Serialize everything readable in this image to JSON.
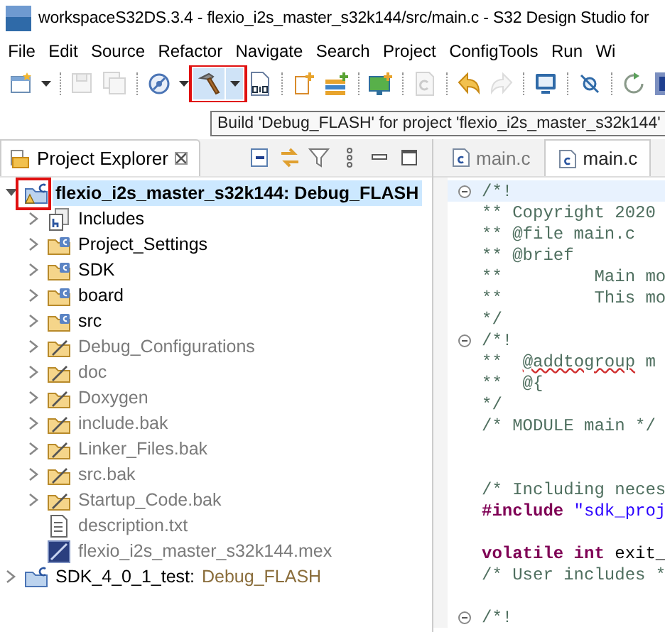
{
  "window": {
    "title": "workspaceS32DS.3.4 - flexio_i2s_master_s32k144/src/main.c - S32 Design Studio for"
  },
  "menu": [
    "File",
    "Edit",
    "Source",
    "Refactor",
    "Navigate",
    "Search",
    "Project",
    "ConfigTools",
    "Run",
    "Wi"
  ],
  "toolbar": [
    {
      "kind": "new",
      "dropdown": true,
      "disabled": false
    },
    {
      "kind": "sep"
    },
    {
      "kind": "save",
      "disabled": true
    },
    {
      "kind": "saveall",
      "disabled": true
    },
    {
      "kind": "sep"
    },
    {
      "kind": "debug",
      "dropdown": true,
      "disabled": false
    },
    {
      "kind": "build",
      "dropdown": true,
      "disabled": false,
      "highlighted": true
    },
    {
      "kind": "binary",
      "disabled": false
    },
    {
      "kind": "sep"
    },
    {
      "kind": "newfile",
      "disabled": false
    },
    {
      "kind": "layers",
      "disabled": false
    },
    {
      "kind": "sep"
    },
    {
      "kind": "monitor",
      "disabled": false
    },
    {
      "kind": "sep"
    },
    {
      "kind": "cfile",
      "disabled": true
    },
    {
      "kind": "sep"
    },
    {
      "kind": "undo",
      "disabled": false
    },
    {
      "kind": "redo",
      "disabled": true
    },
    {
      "kind": "sep"
    },
    {
      "kind": "screen",
      "disabled": false
    },
    {
      "kind": "sep"
    },
    {
      "kind": "probe",
      "disabled": false
    },
    {
      "kind": "sep"
    },
    {
      "kind": "rerun",
      "disabled": false
    },
    {
      "kind": "chip",
      "disabled": false
    }
  ],
  "tooltip": "Build 'Debug_FLASH' for project 'flexio_i2s_master_s32k144'",
  "explorer": {
    "title": "Project Explorer",
    "tree": [
      {
        "kind": "project",
        "name": "flexio_i2s_master_s32k144: Debug_FLASH",
        "selected": true,
        "expanded": true,
        "excluded": false,
        "highlighted": true,
        "children": [
          {
            "kind": "includes",
            "name": "Includes",
            "selected": false,
            "expanded": false,
            "excluded": false
          },
          {
            "kind": "folder",
            "name": "Project_Settings",
            "selected": false,
            "expanded": false,
            "excluded": false
          },
          {
            "kind": "folder",
            "name": "SDK",
            "selected": false,
            "expanded": false,
            "excluded": false
          },
          {
            "kind": "folder",
            "name": "board",
            "selected": false,
            "expanded": false,
            "excluded": false
          },
          {
            "kind": "folder",
            "name": "src",
            "selected": false,
            "expanded": false,
            "excluded": false
          },
          {
            "kind": "folder",
            "name": "Debug_Configurations",
            "selected": false,
            "expanded": false,
            "excluded": true
          },
          {
            "kind": "folder",
            "name": "doc",
            "selected": false,
            "expanded": false,
            "excluded": true
          },
          {
            "kind": "folder",
            "name": "Doxygen",
            "selected": false,
            "expanded": false,
            "excluded": true
          },
          {
            "kind": "folder",
            "name": "include.bak",
            "selected": false,
            "expanded": false,
            "excluded": true
          },
          {
            "kind": "folder",
            "name": "Linker_Files.bak",
            "selected": false,
            "expanded": false,
            "excluded": true
          },
          {
            "kind": "folder",
            "name": "src.bak",
            "selected": false,
            "expanded": false,
            "excluded": true
          },
          {
            "kind": "folder",
            "name": "Startup_Code.bak",
            "selected": false,
            "expanded": false,
            "excluded": true
          },
          {
            "kind": "text",
            "name": "description.txt",
            "selected": false,
            "excluded": true
          },
          {
            "kind": "mex",
            "name": "flexio_i2s_master_s32k144.mex",
            "selected": false,
            "excluded": true
          }
        ]
      },
      {
        "kind": "project",
        "name": "SDK_4_0_1_test:",
        "config": "Debug_FLASH",
        "selected": false,
        "expanded": false,
        "excluded": false
      }
    ]
  },
  "editor": {
    "tabs": [
      {
        "label": "main.c",
        "selected": false
      },
      {
        "label": "main.c",
        "selected": true
      }
    ],
    "lines": [
      {
        "kind": "code",
        "fold": true,
        "current": true,
        "tokens": [
          {
            "kind": "comment",
            "text": "/*!"
          }
        ]
      },
      {
        "kind": "code",
        "tokens": [
          {
            "kind": "comment",
            "text": "** Copyright 2020"
          }
        ]
      },
      {
        "kind": "code",
        "tokens": [
          {
            "kind": "comment",
            "text": "** @file main.c"
          }
        ]
      },
      {
        "kind": "code",
        "tokens": [
          {
            "kind": "comment",
            "text": "** @brief"
          }
        ]
      },
      {
        "kind": "code",
        "tokens": [
          {
            "kind": "comment",
            "text": "**         Main mo"
          }
        ]
      },
      {
        "kind": "code",
        "tokens": [
          {
            "kind": "comment",
            "text": "**         This mo"
          }
        ]
      },
      {
        "kind": "code",
        "tokens": [
          {
            "kind": "comment",
            "text": "*/"
          }
        ]
      },
      {
        "kind": "code",
        "fold": true,
        "tokens": [
          {
            "kind": "comment",
            "text": "/*!"
          }
        ]
      },
      {
        "kind": "code",
        "tokens": [
          {
            "kind": "comment",
            "text": "**  "
          },
          {
            "kind": "misspelled",
            "text": "@addtogroup"
          },
          {
            "kind": "comment",
            "text": " m"
          }
        ]
      },
      {
        "kind": "code",
        "tokens": [
          {
            "kind": "comment",
            "text": "**  @{"
          }
        ]
      },
      {
        "kind": "code",
        "tokens": [
          {
            "kind": "comment",
            "text": "*/"
          }
        ]
      },
      {
        "kind": "code",
        "tokens": [
          {
            "kind": "comment",
            "text": "/* MODULE main */"
          }
        ]
      },
      {
        "kind": "blank"
      },
      {
        "kind": "blank"
      },
      {
        "kind": "code",
        "tokens": [
          {
            "kind": "comment",
            "text": "/* Including neces"
          }
        ]
      },
      {
        "kind": "code",
        "tokens": [
          {
            "kind": "keyword",
            "text": "#include"
          },
          {
            "kind": "string",
            "text": " \"sdk_proj"
          }
        ]
      },
      {
        "kind": "blank"
      },
      {
        "kind": "code",
        "tokens": [
          {
            "kind": "keyword",
            "text": "volatile int"
          },
          {
            "kind": "plain",
            "text": " exit_"
          }
        ]
      },
      {
        "kind": "code",
        "tokens": [
          {
            "kind": "comment",
            "text": "/* User includes *"
          }
        ]
      },
      {
        "kind": "blank"
      },
      {
        "kind": "code",
        "fold": true,
        "tokens": [
          {
            "kind": "comment",
            "text": "/*!"
          }
        ]
      }
    ]
  }
}
